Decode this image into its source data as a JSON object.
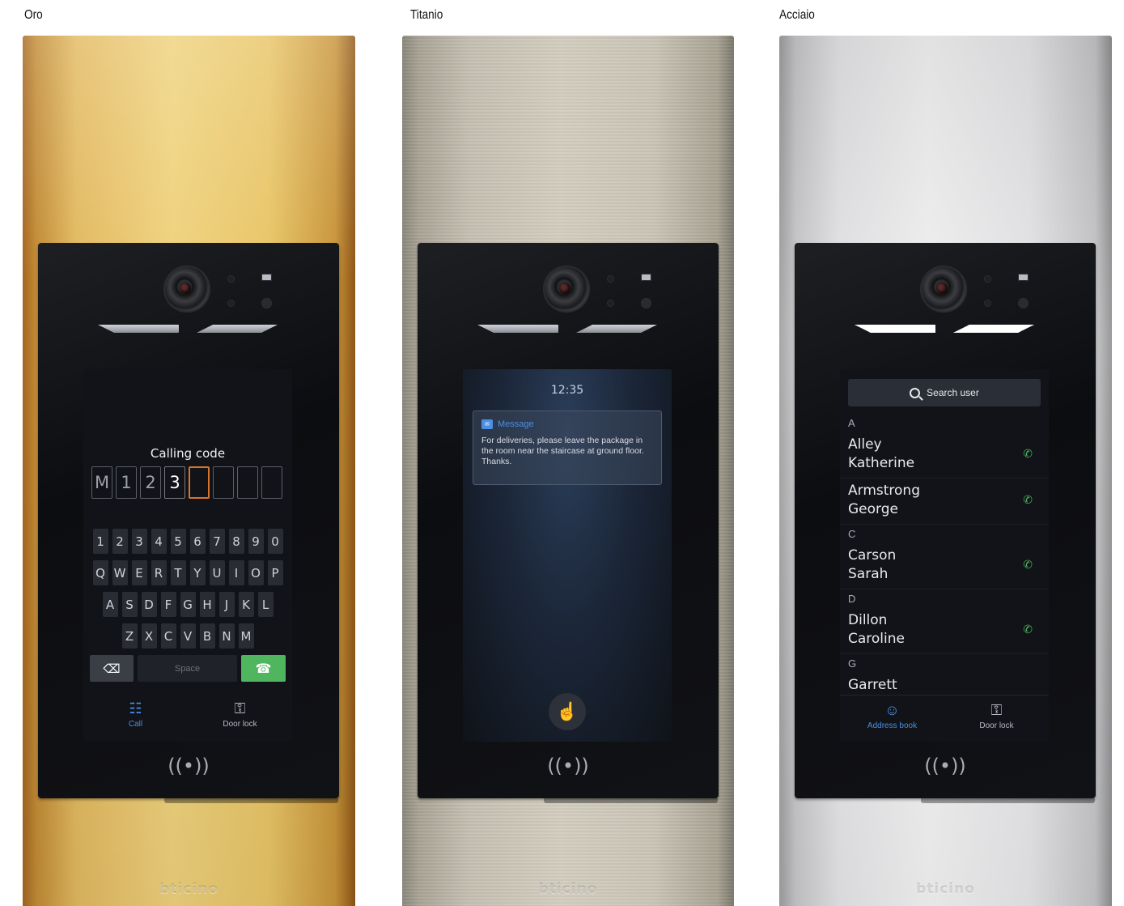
{
  "finishes": [
    {
      "label": "Oro"
    },
    {
      "label": "Titanio"
    },
    {
      "label": "Acciaio"
    }
  ],
  "brand": "bticino",
  "nfc_glyph": "((•))",
  "keypad_screen": {
    "title": "Calling code",
    "code": [
      "M",
      "1",
      "2",
      "3",
      "",
      "",
      "",
      ""
    ],
    "rows": [
      [
        "1",
        "2",
        "3",
        "4",
        "5",
        "6",
        "7",
        "8",
        "9",
        "0"
      ],
      [
        "Q",
        "W",
        "E",
        "R",
        "T",
        "Y",
        "U",
        "I",
        "O",
        "P"
      ],
      [
        "A",
        "S",
        "D",
        "F",
        "G",
        "H",
        "J",
        "K",
        "L"
      ],
      [
        "Z",
        "X",
        "C",
        "V",
        "B",
        "N",
        "M"
      ]
    ],
    "backspace_glyph": "⌫",
    "space_label": "Space",
    "call_glyph": "☎",
    "nav": {
      "call_icon": "☷",
      "call_label": "Call",
      "door_icon": "⚿",
      "door_label": "Door lock"
    }
  },
  "message_screen": {
    "time": "12:35",
    "message_title": "Message",
    "message_body": "For deliveries, please leave the package in the room near the staircase at ground floor. Thanks.",
    "touch_glyph": "☝"
  },
  "addressbook_screen": {
    "search_placeholder": "Search user",
    "call_glyph": "✆",
    "sections": [
      {
        "letter": "A",
        "entries": [
          [
            "Alley",
            "Katherine"
          ],
          [
            "Armstrong",
            "George"
          ]
        ]
      },
      {
        "letter": "C",
        "entries": [
          [
            "Carson",
            "Sarah"
          ]
        ]
      },
      {
        "letter": "D",
        "entries": [
          [
            "Dillon",
            "Caroline"
          ]
        ]
      },
      {
        "letter": "G",
        "entries": [
          [
            "Garrett",
            ""
          ]
        ]
      }
    ],
    "nav": {
      "book_icon": "☺",
      "book_label": "Address book",
      "door_icon": "⚿",
      "door_label": "Door lock"
    }
  },
  "colors": {
    "call_green": "#4fb55e",
    "active_blue": "#4a8fe3",
    "code_cursor": "#d9752b"
  }
}
